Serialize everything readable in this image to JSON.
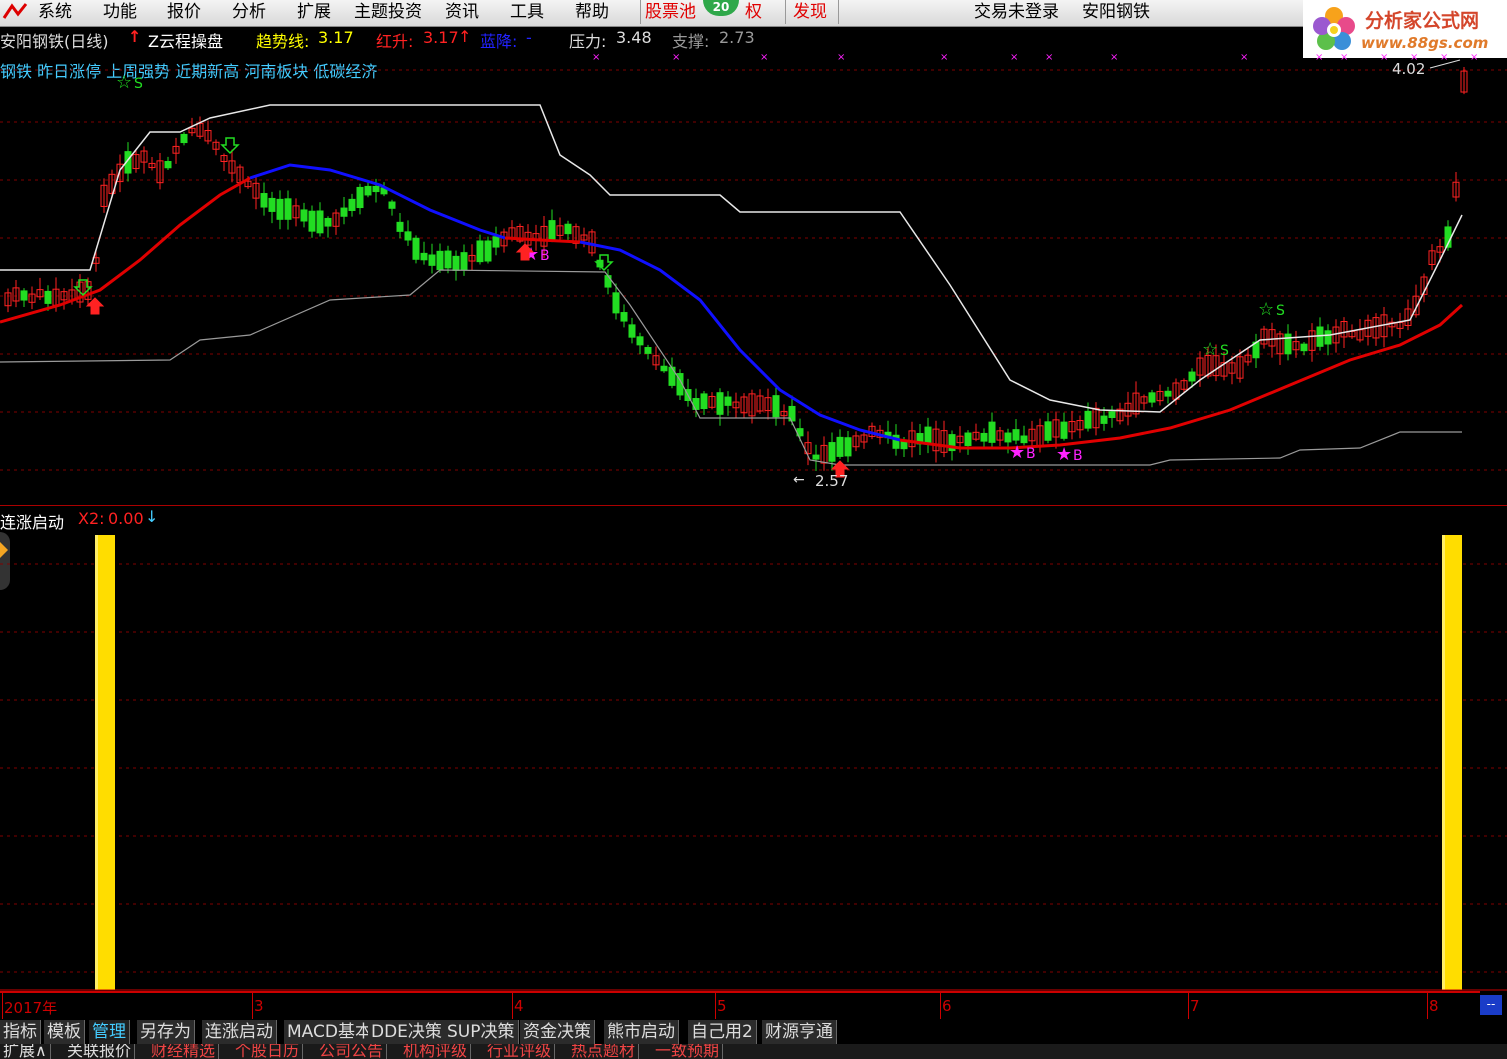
{
  "menu": {
    "items": [
      "系统",
      "功能",
      "报价",
      "分析",
      "扩展",
      "主题投资",
      "资讯",
      "工具",
      "帮助"
    ],
    "stock_pool": "股票池",
    "badge": "20",
    "right_label": "权",
    "discover": "发现",
    "login_status": "交易未登录",
    "stock_name": "安阳钢铁"
  },
  "brand": {
    "title": "分析家公式网",
    "url": "www.88gs.com"
  },
  "info_line1": {
    "stock": "安阳钢铁(日线)",
    "arrow_up": "↑",
    "formula": "Z云程操盘",
    "trend_label": "趋势线: ",
    "trend_value": "3.17",
    "red_label": "红升: ",
    "red_value": "3.17",
    "blue_label": "蓝降: ",
    "blue_value": "-",
    "pressure_label": "压力: ",
    "pressure_value": "3.48",
    "support_label": "支撑: ",
    "support_value": "2.73"
  },
  "info_line2": "钢铁 昨日涨停 上周强势 近期新高 河南板块 低碳经济",
  "annotations": {
    "high_price": "4.02",
    "low_price": "2.57",
    "buy": "B",
    "sell": "S"
  },
  "sub_panel": {
    "indicator": "连涨启动",
    "x2_label": "X2: ",
    "x2_value": "0.00"
  },
  "x_axis": {
    "labels": [
      "2017年",
      "3",
      "4",
      "5",
      "6",
      "7",
      "8"
    ]
  },
  "scroll_button": "--",
  "tabs_row1": [
    "指标",
    "模板",
    "管理",
    "另存为",
    "连涨启动",
    "MACD基本",
    "DDE决策",
    "SUP决策",
    "资金决策",
    "熊市启动",
    "自己用2",
    "财源亨通"
  ],
  "tabs_row1_active": "管理",
  "tabs_row2": [
    "扩展∧",
    "关联报价",
    "财经精选",
    "个股日历",
    "公司公告",
    "机构评级",
    "行业评级",
    "热点题材",
    "一致预期"
  ],
  "colors": {
    "bull": "#ff2222",
    "bear": "#22dd22",
    "trend_up": "#e00000",
    "trend_down": "#1010ff",
    "resistance": "#e8e8e8",
    "support": "#9a9a9a",
    "signal_bar": "#ffdd00",
    "star_buy": "#ff22ff",
    "star_sell": "#22dd22",
    "grid": "#800000"
  }
}
